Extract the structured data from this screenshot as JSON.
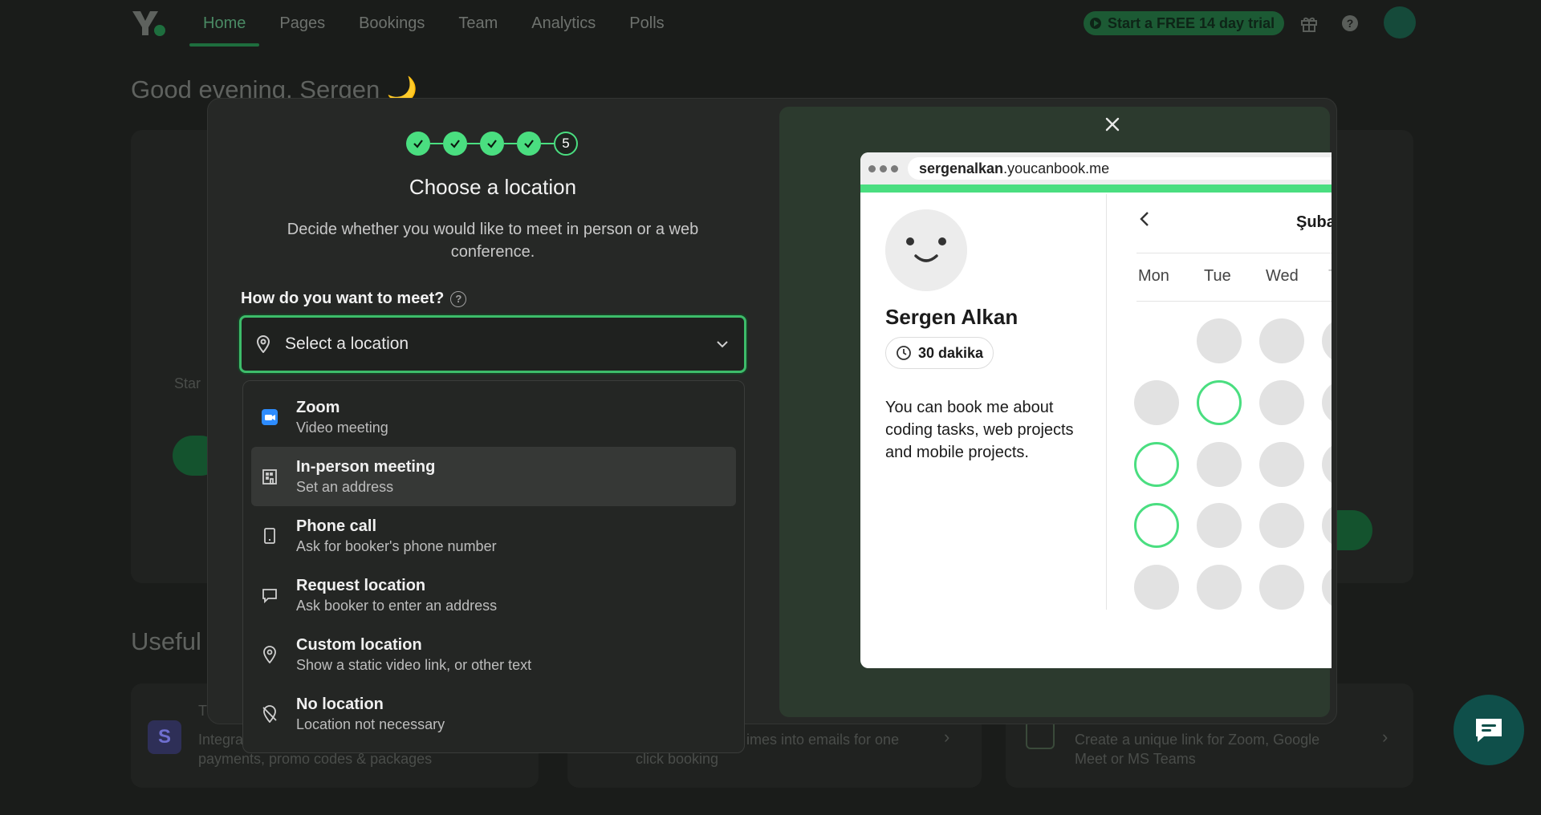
{
  "nav": {
    "tabs": [
      {
        "label": "Home",
        "active": true
      },
      {
        "label": "Pages"
      },
      {
        "label": "Bookings"
      },
      {
        "label": "Team"
      },
      {
        "label": "Analytics"
      },
      {
        "label": "Polls"
      }
    ],
    "trial_label": "Start a FREE 14 day trial",
    "icons": [
      "gift-icon",
      "help-icon",
      "avatar"
    ]
  },
  "background": {
    "greeting": "Good evening, Sergen 🌙",
    "useful_heading": "Useful",
    "card_left_fragment": "Star",
    "tile1": {
      "title": "T",
      "text": "Integr… payments, promo codes & packages"
    },
    "tile1_line1": "Integra",
    "tile1_line2": "payments, promo codes & packages",
    "tile2_line1": "imes into emails for one",
    "tile2_line2": "click booking",
    "tile3_line1": "Create a unique link for Zoom, Google",
    "tile3_line2": "Meet or MS Teams"
  },
  "modal": {
    "steps": [
      {
        "state": "done"
      },
      {
        "state": "done"
      },
      {
        "state": "done"
      },
      {
        "state": "done"
      },
      {
        "state": "current",
        "label": "5"
      }
    ],
    "title": "Choose a location",
    "subtitle": "Decide whether you would like to meet in person or a web conference.",
    "field_label": "How do you want to meet?",
    "select_placeholder": "Select a location",
    "options": [
      {
        "title": "Zoom",
        "desc": "Video meeting",
        "icon": "zoom-icon"
      },
      {
        "title": "In-person meeting",
        "desc": "Set an address",
        "icon": "building-icon",
        "hovered": true
      },
      {
        "title": "Phone call",
        "desc": "Ask for booker's phone number",
        "icon": "phone-icon"
      },
      {
        "title": "Request location",
        "desc": "Ask booker to enter an address",
        "icon": "chat-bubble-icon"
      },
      {
        "title": "Custom location",
        "desc": "Show a static video link, or other text",
        "icon": "map-pin-icon"
      },
      {
        "title": "No location",
        "desc": "Location not necessary",
        "icon": "map-pin-off-icon"
      }
    ]
  },
  "preview": {
    "url_bold": "sergenalkan",
    "url_rest": ".youcanbook.me",
    "name": "Sergen Alkan",
    "duration": "30 dakika",
    "description": "You can book me about coding tasks, web projects and mobile projects.",
    "month": "Şuba",
    "days": [
      "Mon",
      "Tue",
      "Wed",
      "T"
    ]
  },
  "colors": {
    "accent": "#4ade80",
    "focus_border": "#3dbc6a",
    "modal_bg": "#262826",
    "page_bg": "#1a1c1a"
  }
}
